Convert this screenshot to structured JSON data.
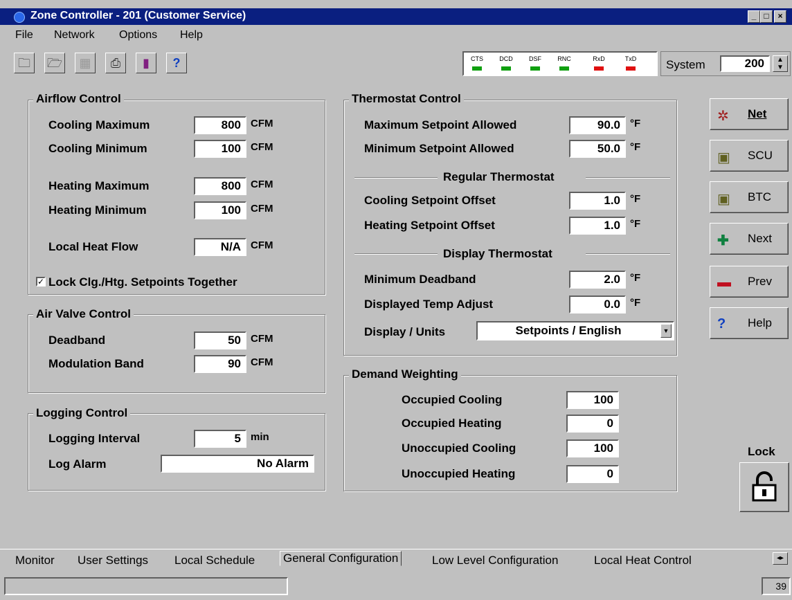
{
  "window": {
    "title": "Zone Controller - 201  (Customer Service)"
  },
  "menu": [
    "File",
    "Network",
    "Options",
    "Help"
  ],
  "toolbar_icons": [
    "open-file-icon",
    "save-file-icon",
    "disabled-icon",
    "print-icon",
    "chart-icon",
    "help-icon"
  ],
  "status_leds": [
    {
      "label": "CTS",
      "color": "#10a010"
    },
    {
      "label": "DCD",
      "color": "#10a010"
    },
    {
      "label": "DSF",
      "color": "#10a010"
    },
    {
      "label": "RNC",
      "color": "#10a010"
    },
    {
      "label": "RxD",
      "color": "#e01010"
    },
    {
      "label": "TxD",
      "color": "#e01010"
    }
  ],
  "system": {
    "label": "System",
    "value": "200"
  },
  "airflow": {
    "title": "Airflow Control",
    "rows": [
      {
        "label": "Cooling Maximum",
        "value": "800",
        "unit": "CFM"
      },
      {
        "label": "Cooling Minimum",
        "value": "100",
        "unit": "CFM"
      },
      {
        "label": "Heating Maximum",
        "value": "800",
        "unit": "CFM"
      },
      {
        "label": "Heating Minimum",
        "value": "100",
        "unit": "CFM"
      },
      {
        "label": "Local Heat Flow",
        "value": "N/A",
        "unit": "CFM"
      }
    ],
    "lock_checkbox": "Lock Clg./Htg. Setpoints Together"
  },
  "air_valve": {
    "title": "Air Valve Control",
    "rows": [
      {
        "label": "Deadband",
        "value": "50",
        "unit": "CFM"
      },
      {
        "label": "Modulation Band",
        "value": "90",
        "unit": "CFM"
      }
    ]
  },
  "logging": {
    "title": "Logging Control",
    "interval_label": "Logging Interval",
    "interval_value": "5",
    "interval_unit": "min",
    "alarm_label": "Log Alarm",
    "alarm_value": "No Alarm"
  },
  "thermostat": {
    "title": "Thermostat Control",
    "rows": [
      {
        "label": "Maximum Setpoint Allowed",
        "value": "90.0",
        "unit": "°F"
      },
      {
        "label": "Minimum Setpoint Allowed",
        "value": "50.0",
        "unit": "°F"
      }
    ],
    "regular_title": "Regular Thermostat",
    "regular_rows": [
      {
        "label": "Cooling Setpoint Offset",
        "value": "1.0",
        "unit": "°F"
      },
      {
        "label": "Heating Setpoint Offset",
        "value": "1.0",
        "unit": "°F"
      }
    ],
    "display_title": "Display Thermostat",
    "display_rows": [
      {
        "label": "Minimum Deadband",
        "value": "2.0",
        "unit": "°F"
      },
      {
        "label": "Displayed Temp Adjust",
        "value": "0.0",
        "unit": "°F"
      }
    ],
    "units_label": "Display / Units",
    "units_value": "Setpoints / English"
  },
  "demand": {
    "title": "Demand Weighting",
    "rows": [
      {
        "label": "Occupied Cooling",
        "value": "100"
      },
      {
        "label": "Occupied Heating",
        "value": "0"
      },
      {
        "label": "Unoccupied Cooling",
        "value": "100"
      },
      {
        "label": "Unoccupied Heating",
        "value": "0"
      }
    ]
  },
  "side_buttons": [
    {
      "label": "Net",
      "icon": "network-icon"
    },
    {
      "label": "SCU",
      "icon": "computer-icon"
    },
    {
      "label": "BTC",
      "icon": "computer-icon"
    },
    {
      "label": "Next",
      "icon": "plus-icon"
    },
    {
      "label": "Prev",
      "icon": "minus-icon"
    },
    {
      "label": "Help",
      "icon": "question-icon"
    }
  ],
  "lock": {
    "label": "Lock"
  },
  "tabs": [
    "Monitor",
    "User Settings",
    "Local Schedule",
    "General Configuration",
    "Low Level Configuration",
    "Local Heat Control"
  ],
  "status_bar": {
    "number": "39"
  }
}
